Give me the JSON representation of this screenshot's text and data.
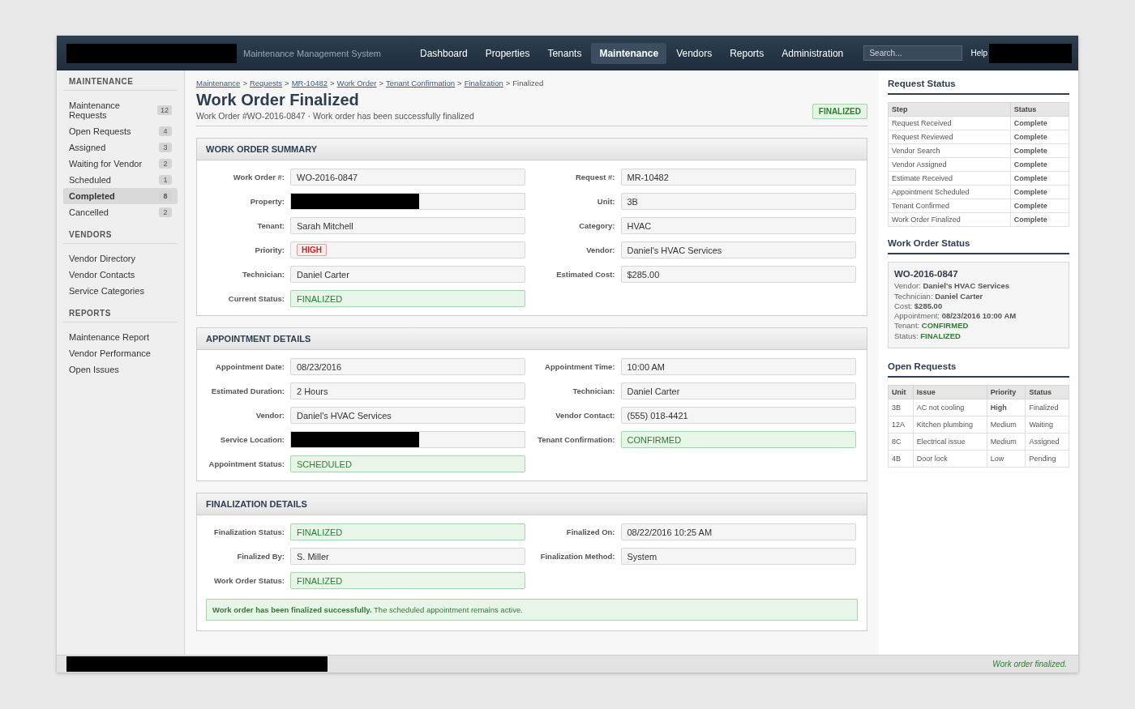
{
  "header": {
    "app_name": "Maintenance Management System",
    "nav": [
      {
        "label": "Dashboard",
        "selected": false
      },
      {
        "label": "Properties",
        "selected": false
      },
      {
        "label": "Tenants",
        "selected": false
      },
      {
        "label": "Maintenance",
        "selected": true
      },
      {
        "label": "Vendors",
        "selected": false
      },
      {
        "label": "Reports",
        "selected": false
      },
      {
        "label": "Administration",
        "selected": false
      }
    ],
    "search": {
      "placeholder": "Search..."
    },
    "help": "Help"
  },
  "sidebar": [
    {
      "title": "MAINTENANCE",
      "items": [
        {
          "label": "Maintenance Requests",
          "count": "12",
          "selected": false
        },
        {
          "label": "Open Requests",
          "count": "4",
          "selected": false
        },
        {
          "label": "Assigned",
          "count": "3",
          "selected": false
        },
        {
          "label": "Waiting for Vendor",
          "count": "2",
          "selected": false
        },
        {
          "label": "Scheduled",
          "count": "1",
          "selected": false
        },
        {
          "label": "Completed",
          "count": "8",
          "selected": true
        },
        {
          "label": "Cancelled",
          "count": "2",
          "selected": false
        }
      ]
    },
    {
      "title": "VENDORS",
      "items": [
        {
          "label": "Vendor Directory",
          "selected": false
        },
        {
          "label": "Vendor Contacts",
          "selected": false
        },
        {
          "label": "Service Categories",
          "selected": false
        }
      ]
    },
    {
      "title": "REPORTS",
      "items": [
        {
          "label": "Maintenance Report",
          "selected": false
        },
        {
          "label": "Vendor Performance",
          "selected": false
        },
        {
          "label": "Open Issues",
          "selected": false
        }
      ]
    }
  ],
  "breadcrumb": {
    "links": [
      "Maintenance",
      "Requests",
      "MR-10482",
      "Work Order",
      "Tenant Confirmation",
      "Finalization"
    ],
    "separator": ">",
    "current": "Finalized"
  },
  "page": {
    "title": "Work Order Finalized",
    "subtitle": "Work Order #WO-2016-0847 · Work order has been successfully finalized",
    "badge": "FINALIZED"
  },
  "panels": [
    {
      "title": "WORK ORDER SUMMARY",
      "fields": [
        {
          "label": "Work Order #:",
          "value": "WO-2016-0847",
          "kind": "text"
        },
        {
          "label": "Request #:",
          "value": "MR-10482",
          "kind": "text"
        },
        {
          "label": "Property:",
          "kind": "redacted"
        },
        {
          "label": "Unit:",
          "value": "3B",
          "kind": "text"
        },
        {
          "label": "Tenant:",
          "value": "Sarah Mitchell",
          "kind": "text"
        },
        {
          "label": "Category:",
          "value": "HVAC",
          "kind": "text"
        },
        {
          "label": "Priority:",
          "value": "HIGH",
          "kind": "priority"
        },
        {
          "label": "Vendor:",
          "value": "Daniel's HVAC Services",
          "kind": "text"
        },
        {
          "label": "Technician:",
          "value": "Daniel Carter",
          "kind": "text"
        },
        {
          "label": "Estimated Cost:",
          "value": "$285.00",
          "kind": "text"
        },
        {
          "label": "Current Status:",
          "value": "FINALIZED",
          "kind": "success"
        }
      ]
    },
    {
      "title": "APPOINTMENT DETAILS",
      "fields": [
        {
          "label": "Appointment Date:",
          "value": "08/23/2016",
          "kind": "text"
        },
        {
          "label": "Appointment Time:",
          "value": "10:00 AM",
          "kind": "text"
        },
        {
          "label": "Estimated Duration:",
          "value": "2 Hours",
          "kind": "text"
        },
        {
          "label": "Technician:",
          "value": "Daniel Carter",
          "kind": "text"
        },
        {
          "label": "Vendor:",
          "value": "Daniel's HVAC Services",
          "kind": "text"
        },
        {
          "label": "Vendor Contact:",
          "value": "(555) 018-4421",
          "kind": "text"
        },
        {
          "label": "Service Location:",
          "kind": "redacted"
        },
        {
          "label": "Tenant Confirmation:",
          "value": "CONFIRMED",
          "kind": "success"
        },
        {
          "label": "Appointment Status:",
          "value": "SCHEDULED",
          "kind": "success"
        }
      ]
    },
    {
      "title": "FINALIZATION DETAILS",
      "fields": [
        {
          "label": "Finalization Status:",
          "value": "FINALIZED",
          "kind": "success"
        },
        {
          "label": "Finalized On:",
          "value": "08/22/2016 10:25 AM",
          "kind": "text"
        },
        {
          "label": "Finalized By:",
          "value": "S. Miller",
          "kind": "text"
        },
        {
          "label": "Finalization Method:",
          "value": "System",
          "kind": "text"
        },
        {
          "label": "Work Order Status:",
          "value": "FINALIZED",
          "kind": "success"
        }
      ],
      "alert": "**Work order has been finalized successfully.** The scheduled appointment remains active."
    }
  ],
  "request_status": {
    "title": "Request Status",
    "columns": [
      "Step",
      "Status"
    ],
    "rows": [
      [
        "Request Received",
        "Complete"
      ],
      [
        "Request Reviewed",
        "Complete"
      ],
      [
        "Vendor Search",
        "Complete"
      ],
      [
        "Vendor Assigned",
        "Complete"
      ],
      [
        "Estimate Received",
        "Complete"
      ],
      [
        "Appointment Scheduled",
        "Complete"
      ],
      [
        "Tenant Confirmed",
        "Complete"
      ],
      [
        "Work Order Finalized",
        "Complete"
      ]
    ]
  },
  "work_order_status": {
    "title": "Work Order Status",
    "card_title": "WO-2016-0847",
    "lines": [
      {
        "label": "Vendor:",
        "value": "Daniel's HVAC Services",
        "kind": "plain"
      },
      {
        "label": "Technician:",
        "value": "Daniel Carter",
        "kind": "plain"
      },
      {
        "label": "Cost:",
        "value": "$285.00",
        "kind": "plain"
      },
      {
        "label": "Appointment:",
        "value": "08/23/2016 10:00 AM",
        "kind": "plain"
      },
      {
        "label": "Tenant:",
        "value": "CONFIRMED",
        "kind": "success"
      },
      {
        "label": "Status:",
        "value": "FINALIZED",
        "kind": "success"
      }
    ]
  },
  "open_requests": {
    "title": "Open Requests",
    "columns": [
      "Unit",
      "Issue",
      "Priority",
      "Status"
    ],
    "rows": [
      {
        "unit": "3B",
        "issue": "AC not cooling",
        "priority": "High",
        "status": "Finalized",
        "urgent": true
      },
      {
        "unit": "12A",
        "issue": "Kitchen plumbing",
        "priority": "Medium",
        "status": "Waiting",
        "urgent": false
      },
      {
        "unit": "8C",
        "issue": "Electrical issue",
        "priority": "Medium",
        "status": "Assigned",
        "urgent": false
      },
      {
        "unit": "4B",
        "issue": "Door lock",
        "priority": "Low",
        "status": "Pending",
        "urgent": false
      }
    ]
  },
  "status_bar": {
    "message": "Work order finalized."
  }
}
